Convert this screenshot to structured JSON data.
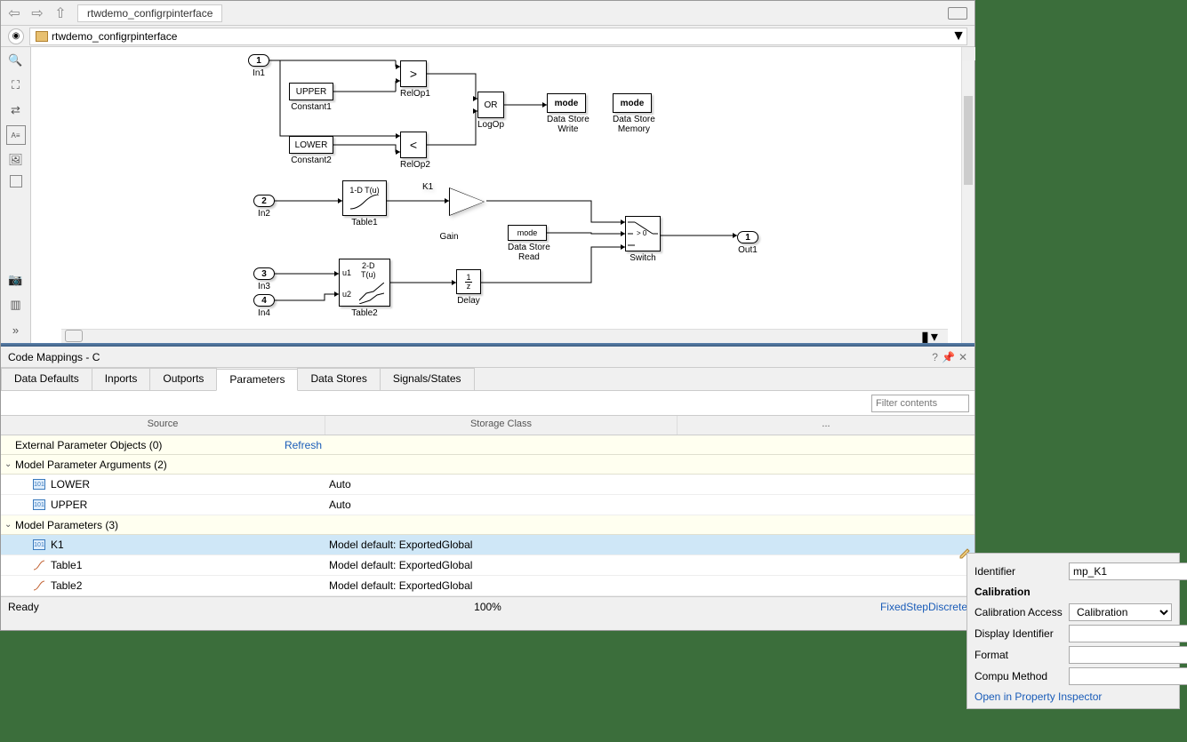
{
  "toolbar": {
    "tab_name": "rtwdemo_configrpinterface"
  },
  "breadcrumb": {
    "path": "rtwdemo_configrpinterface"
  },
  "blocks": {
    "in1": "In1",
    "in2": "In2",
    "in3": "In3",
    "in4": "In4",
    "out1": "Out1",
    "in1_num": "1",
    "in2_num": "2",
    "in3_num": "3",
    "in4_num": "4",
    "out1_num": "1",
    "upper": "UPPER",
    "lower": "LOWER",
    "constant1": "Constant1",
    "constant2": "Constant2",
    "relop1": "RelOp1",
    "relop2": "RelOp2",
    "relop1_sym": ">",
    "relop2_sym": "<",
    "logop": "LogOp",
    "logop_sym": "OR",
    "dsw": "Data Store\nWrite",
    "dsm": "Data Store\nMemory",
    "dsr": "Data Store\nRead",
    "mode": "mode",
    "table1": "Table1",
    "table1_sym": "1-D T(u)",
    "table2": "Table2",
    "table2_sym": "2-D\nT(u)",
    "table2_u1": "u1",
    "table2_u2": "u2",
    "gain": "Gain",
    "gain_sym": "K1",
    "delay": "Delay",
    "delay_sym": "1\nz",
    "switch": "Switch",
    "switch_sym": "> 0"
  },
  "code_mappings": {
    "title": "Code Mappings - C",
    "tabs": [
      "Data Defaults",
      "Inports",
      "Outports",
      "Parameters",
      "Data Stores",
      "Signals/States"
    ],
    "filter_placeholder": "Filter contents",
    "columns": {
      "c1": "Source",
      "c2": "Storage Class",
      "c3": "..."
    },
    "section1": "External Parameter Objects (0)",
    "refresh": "Refresh",
    "section2": "Model Parameter Arguments (2)",
    "section3": "Model Parameters (3)",
    "rows_args": [
      {
        "name": "LOWER",
        "storage": "Auto"
      },
      {
        "name": "UPPER",
        "storage": "Auto"
      }
    ],
    "rows_params": [
      {
        "name": "K1",
        "storage": "Model default: ExportedGlobal"
      },
      {
        "name": "Table1",
        "storage": "Model default: ExportedGlobal"
      },
      {
        "name": "Table2",
        "storage": "Model default: ExportedGlobal"
      }
    ]
  },
  "status": {
    "left": "Ready",
    "center": "100%",
    "right": "FixedStepDiscrete"
  },
  "properties": {
    "identifier_label": "Identifier",
    "identifier_value": "mp_K1",
    "heading": "Calibration",
    "access_label": "Calibration Access",
    "access_value": "Calibration",
    "display_label": "Display Identifier",
    "format_label": "Format",
    "compu_label": "Compu Method",
    "link": "Open in Property Inspector"
  }
}
